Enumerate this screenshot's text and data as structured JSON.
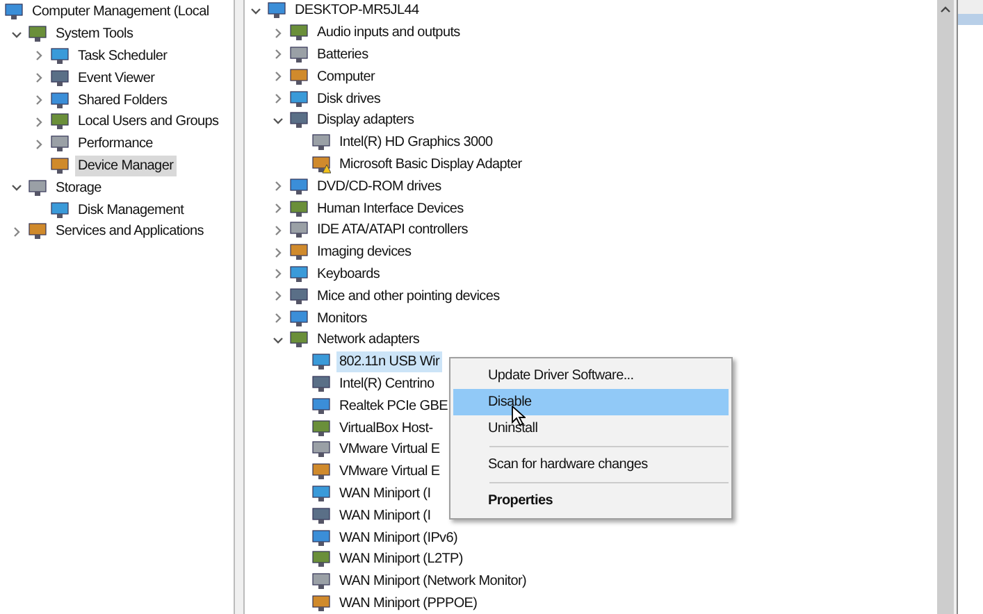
{
  "navigation_tree": [
    {
      "label": "Computer Management (Local",
      "selected": false,
      "children": [
        {
          "label": "System Tools",
          "expanded": true,
          "selected": false,
          "children": [
            {
              "label": "Task Scheduler",
              "expanded": false,
              "selected": false
            },
            {
              "label": "Event Viewer",
              "expanded": false,
              "selected": false
            },
            {
              "label": "Shared Folders",
              "expanded": false,
              "selected": false
            },
            {
              "label": "Local Users and Groups",
              "expanded": false,
              "selected": false
            },
            {
              "label": "Performance",
              "expanded": false,
              "selected": false
            },
            {
              "label": "Device Manager",
              "selected": true
            }
          ]
        },
        {
          "label": "Storage",
          "expanded": true,
          "selected": false,
          "children": [
            {
              "label": "Disk Management",
              "selected": false
            }
          ]
        },
        {
          "label": "Services and Applications",
          "expanded": false,
          "selected": false
        }
      ]
    }
  ],
  "device_tree": [
    {
      "label": "DESKTOP-MR5JL44",
      "expanded": true,
      "selected": false,
      "children": [
        {
          "label": "Audio inputs and outputs",
          "expanded": false,
          "selected": false
        },
        {
          "label": "Batteries",
          "expanded": false,
          "selected": false
        },
        {
          "label": "Computer",
          "expanded": false,
          "selected": false
        },
        {
          "label": "Disk drives",
          "expanded": false,
          "selected": false
        },
        {
          "label": "Display adapters",
          "expanded": true,
          "selected": false,
          "children": [
            {
              "label": "Intel(R) HD Graphics 3000",
              "selected": false
            },
            {
              "label": "Microsoft Basic Display Adapter",
              "selected": false,
              "warning": true
            }
          ]
        },
        {
          "label": "DVD/CD-ROM drives",
          "expanded": false,
          "selected": false
        },
        {
          "label": "Human Interface Devices",
          "expanded": false,
          "selected": false
        },
        {
          "label": "IDE ATA/ATAPI controllers",
          "expanded": false,
          "selected": false
        },
        {
          "label": "Imaging devices",
          "expanded": false,
          "selected": false
        },
        {
          "label": "Keyboards",
          "expanded": false,
          "selected": false
        },
        {
          "label": "Mice and other pointing devices",
          "expanded": false,
          "selected": false
        },
        {
          "label": "Monitors",
          "expanded": false,
          "selected": false
        },
        {
          "label": "Network adapters",
          "expanded": true,
          "selected": false,
          "children": [
            {
              "label": "802.11n USB Wir",
              "selected": true
            },
            {
              "label": "Intel(R) Centrino",
              "selected": false
            },
            {
              "label": "Realtek PCIe GBE",
              "selected": false
            },
            {
              "label": "VirtualBox Host-",
              "selected": false
            },
            {
              "label": "VMware Virtual E",
              "selected": false
            },
            {
              "label": "VMware Virtual E",
              "selected": false
            },
            {
              "label": "WAN Miniport (I",
              "selected": false
            },
            {
              "label": "WAN Miniport (I",
              "selected": false
            },
            {
              "label": "WAN Miniport (IPv6)",
              "selected": false
            },
            {
              "label": "WAN Miniport (L2TP)",
              "selected": false
            },
            {
              "label": "WAN Miniport (Network Monitor)",
              "selected": false
            },
            {
              "label": "WAN Miniport (PPPOE)",
              "selected": false
            }
          ]
        }
      ]
    }
  ],
  "context_menu": [
    {
      "kind": "item",
      "label": "Update Driver Software...",
      "selected": false
    },
    {
      "kind": "item",
      "label": "Disable",
      "selected": true
    },
    {
      "kind": "item",
      "label": "Uninstall",
      "selected": false
    },
    {
      "kind": "separator"
    },
    {
      "kind": "item",
      "label": "Scan for hardware changes",
      "selected": false
    },
    {
      "kind": "separator"
    },
    {
      "kind": "bold",
      "label": "Properties",
      "selected": false
    }
  ]
}
